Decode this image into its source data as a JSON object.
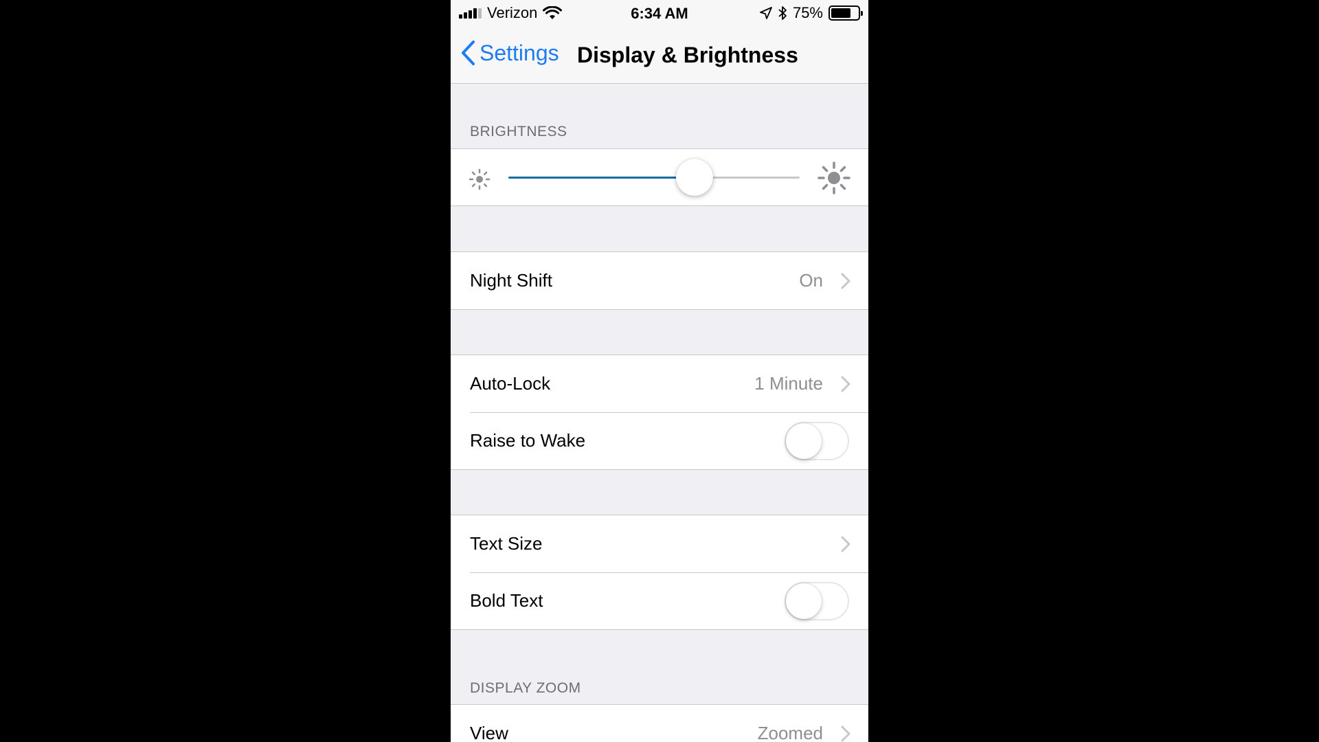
{
  "status_bar": {
    "carrier": "Verizon",
    "time": "6:34 AM",
    "battery_percent": "75%",
    "battery_level": 0.75,
    "icons": [
      "signal-icon",
      "wifi-icon",
      "location-icon",
      "bluetooth-icon",
      "battery-icon"
    ]
  },
  "nav": {
    "back_label": "Settings",
    "title": "Display & Brightness"
  },
  "brightness": {
    "header": "BRIGHTNESS",
    "level": 0.64
  },
  "night_shift": {
    "label": "Night Shift",
    "value": "On"
  },
  "auto_lock": {
    "label": "Auto-Lock",
    "value": "1 Minute"
  },
  "raise_to_wake": {
    "label": "Raise to Wake",
    "enabled": false
  },
  "text_size": {
    "label": "Text Size"
  },
  "bold_text": {
    "label": "Bold Text",
    "enabled": false
  },
  "display_zoom": {
    "header": "DISPLAY ZOOM",
    "view_label": "View",
    "view_value": "Zoomed"
  },
  "colors": {
    "accent": "#1d7cf2",
    "slider_fill": "#1a6aa5",
    "background": "#efeff4",
    "secondary_text": "#8e8e93"
  }
}
